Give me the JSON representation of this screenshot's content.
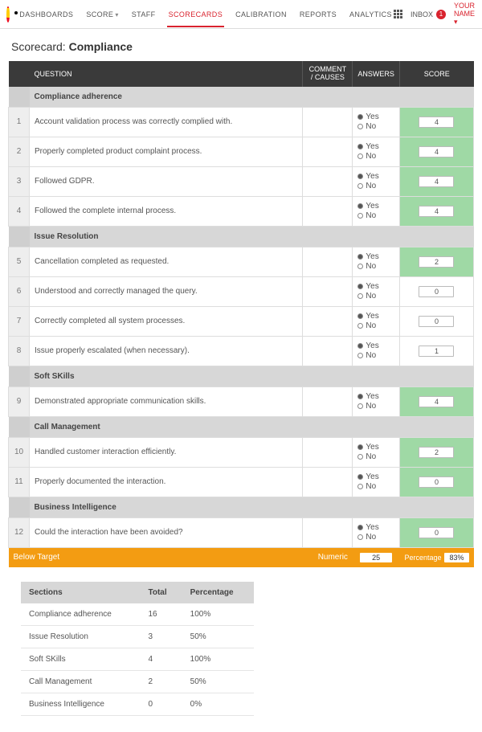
{
  "nav": {
    "items": [
      "DASHBOARDS",
      "SCORE",
      "STAFF",
      "SCORECARDS",
      "CALIBRATION",
      "REPORTS",
      "ANALYTICS"
    ],
    "dropdown_indices": [
      1
    ],
    "active_index": 3,
    "inbox_label": "INBOX",
    "inbox_count": "1",
    "username": "YOUR NAME"
  },
  "page": {
    "title_prefix": "Scorecard: ",
    "title_name": "Compliance"
  },
  "headers": {
    "question": "QUESTION",
    "comment_causes": "COMMENT / CAUSES",
    "answers": "ANSWERS",
    "score": "SCORE"
  },
  "answer_labels": {
    "yes": "Yes",
    "no": "No"
  },
  "sections": [
    {
      "name": "Compliance adherence",
      "questions": [
        {
          "num": "1",
          "text": "Account validation process was correctly complied with.",
          "yes": true,
          "score": "4",
          "green": true
        },
        {
          "num": "2",
          "text": "Properly completed product complaint process.",
          "yes": true,
          "score": "4",
          "green": true
        },
        {
          "num": "3",
          "text": "Followed GDPR.",
          "yes": true,
          "score": "4",
          "green": true
        },
        {
          "num": "4",
          "text": "Followed  the complete internal process.",
          "yes": true,
          "score": "4",
          "green": true
        }
      ]
    },
    {
      "name": "Issue Resolution",
      "questions": [
        {
          "num": "5",
          "text": "Cancellation completed as requested.",
          "yes": true,
          "score": "2",
          "green": true
        },
        {
          "num": "6",
          "text": "Understood and correctly managed the query.",
          "yes": true,
          "score": "0",
          "green": false
        },
        {
          "num": "7",
          "text": "Correctly completed all system processes.",
          "yes": true,
          "score": "0",
          "green": false
        },
        {
          "num": "8",
          "text": "Issue properly escalated (when necessary).",
          "yes": true,
          "score": "1",
          "green": false
        }
      ]
    },
    {
      "name": "Soft SKills",
      "questions": [
        {
          "num": "9",
          "text": "Demonstrated appropriate communication skills.",
          "yes": true,
          "score": "4",
          "green": true
        }
      ]
    },
    {
      "name": "Call Management",
      "questions": [
        {
          "num": "10",
          "text": "Handled customer interaction efficiently.",
          "yes": true,
          "score": "2",
          "green": true
        },
        {
          "num": "11",
          "text": "Properly documented the interaction.",
          "yes": true,
          "score": "0",
          "green": true
        }
      ]
    },
    {
      "name": "Business Intelligence",
      "questions": [
        {
          "num": "12",
          "text": "Could the interaction have been avoided?",
          "yes": true,
          "score": "0",
          "green": true
        }
      ]
    }
  ],
  "footer": {
    "status": "Below Target",
    "numeric_label": "Numeric",
    "numeric_value": "25",
    "percentage_label": "Percentage",
    "percentage_value": "83%"
  },
  "summary": {
    "headers": {
      "sections": "Sections",
      "total": "Total",
      "percentage": "Percentage"
    },
    "rows": [
      {
        "name": "Compliance adherence",
        "total": "16",
        "pct": "100%"
      },
      {
        "name": "Issue Resolution",
        "total": "3",
        "pct": "50%"
      },
      {
        "name": "Soft SKills",
        "total": "4",
        "pct": "100%"
      },
      {
        "name": "Call Management",
        "total": "2",
        "pct": "50%"
      },
      {
        "name": "Business Intelligence",
        "total": "0",
        "pct": "0%"
      }
    ]
  }
}
